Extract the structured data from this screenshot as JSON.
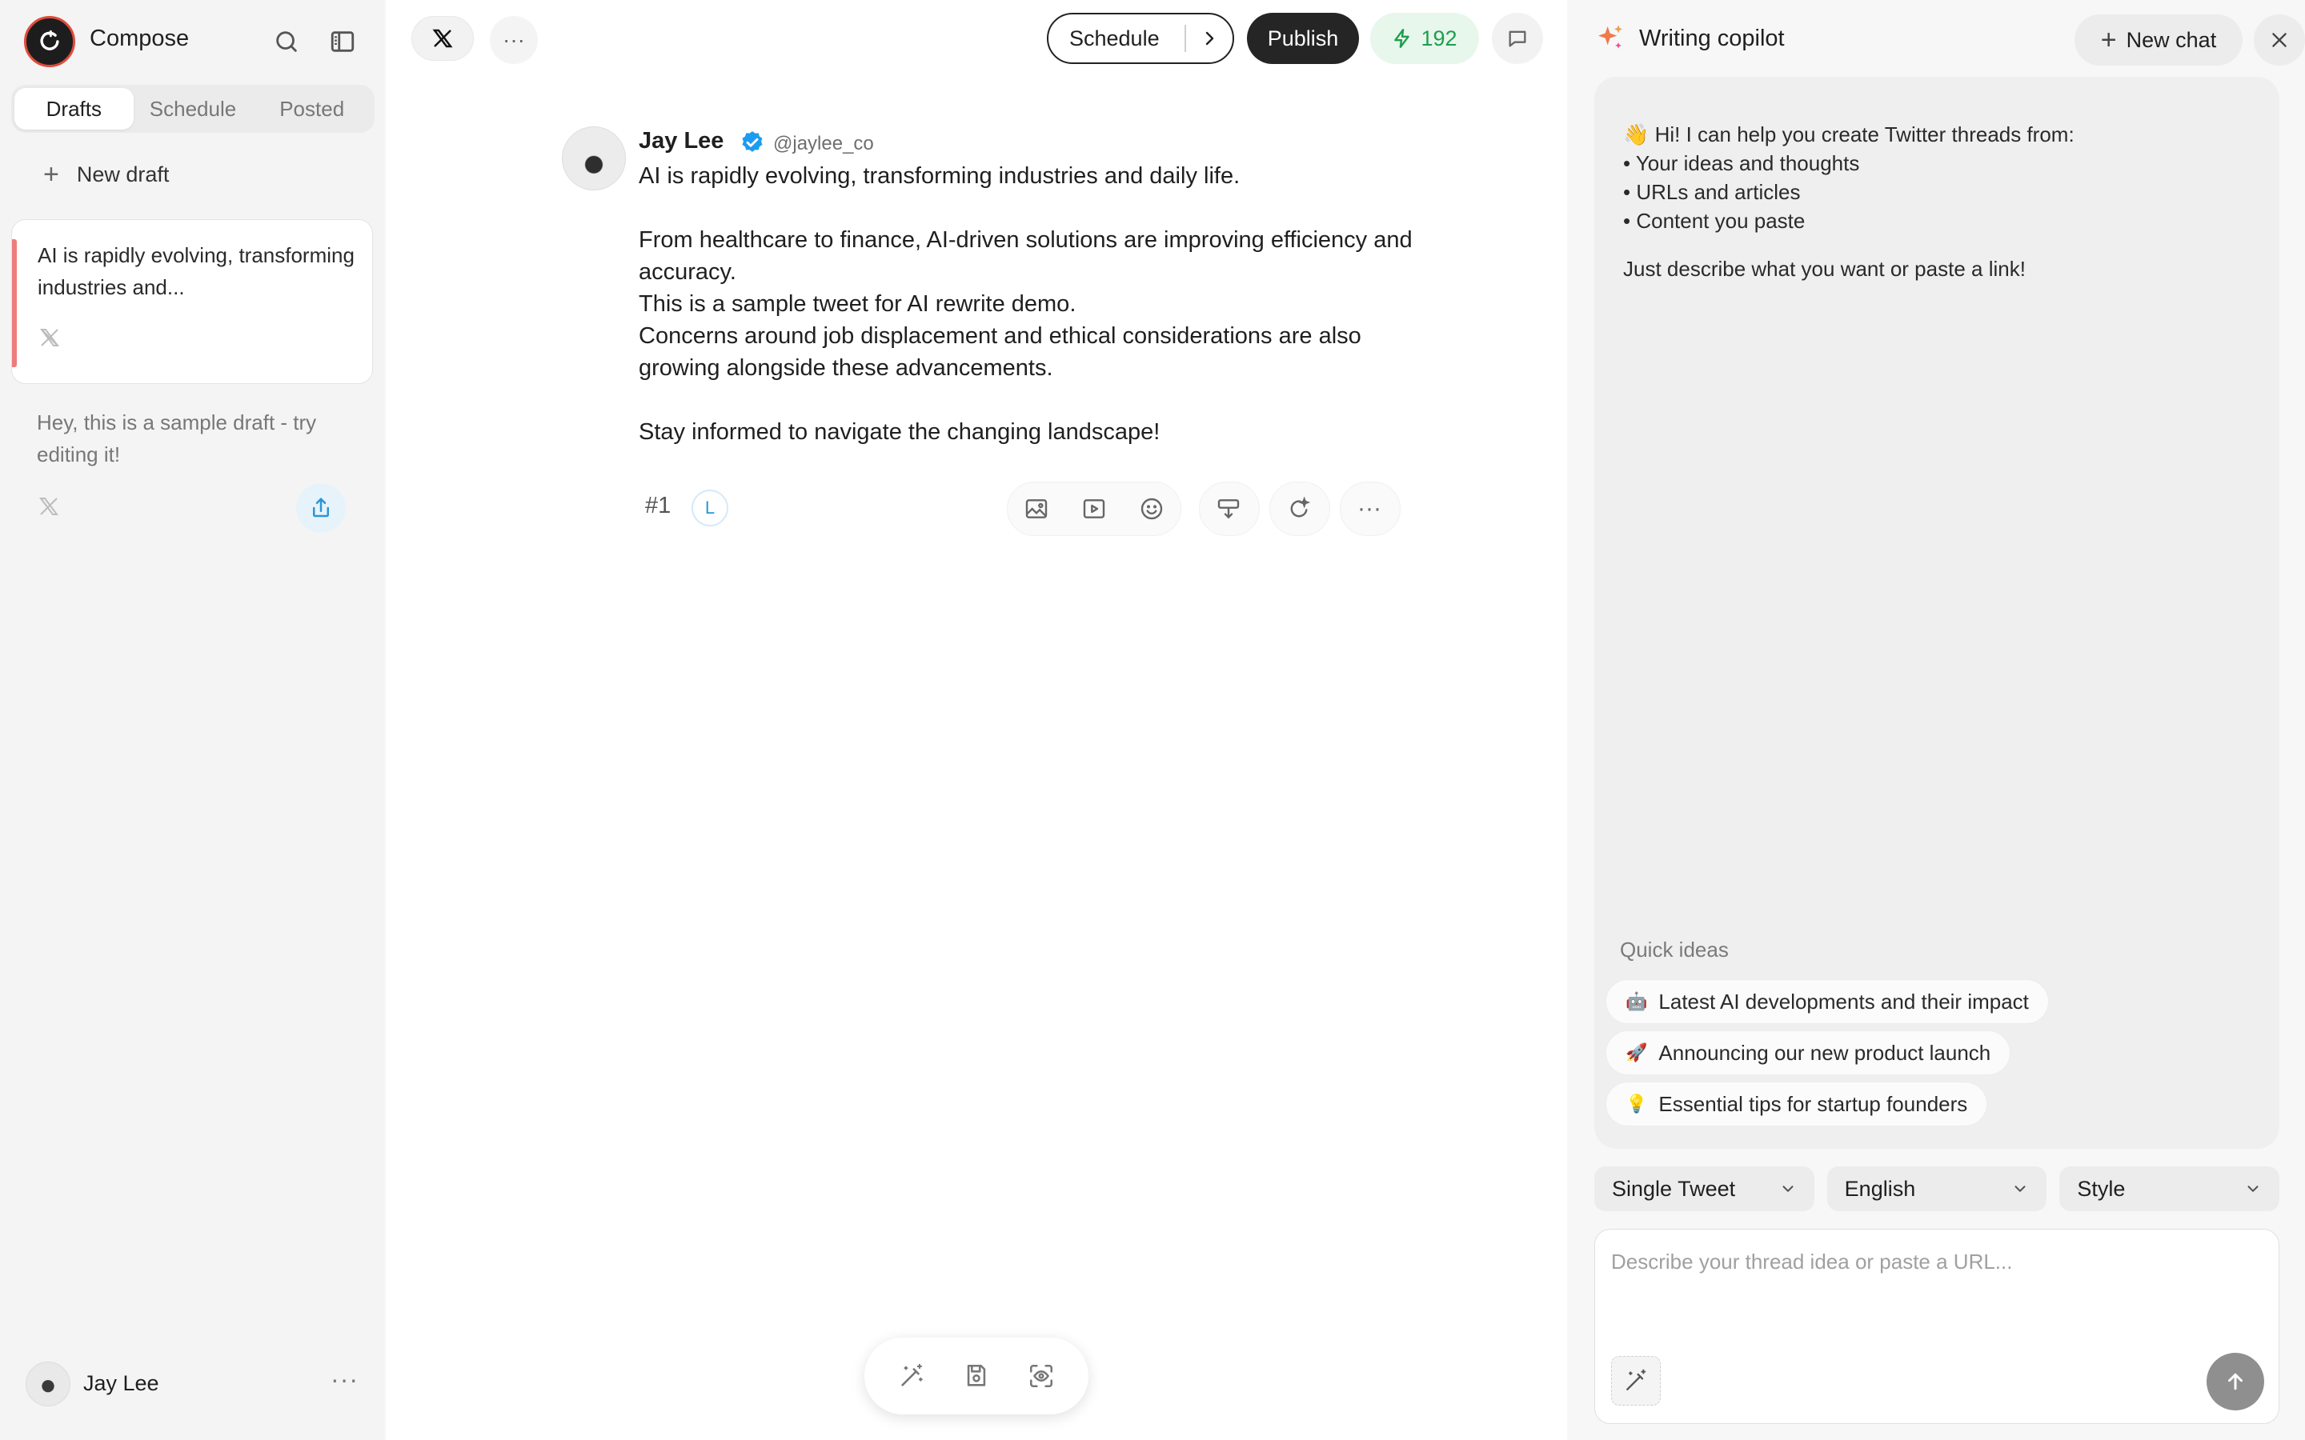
{
  "sidebar": {
    "title": "Compose",
    "tabs": [
      {
        "label": "Drafts",
        "active": true
      },
      {
        "label": "Schedule",
        "active": false
      },
      {
        "label": "Posted",
        "active": false
      }
    ],
    "new_draft_label": "New draft",
    "drafts": [
      {
        "text": "AI is rapidly evolving, transforming industries and...",
        "platform_icon": "x-logo-icon",
        "selected": true
      },
      {
        "text": "Hey, this is a sample draft - try editing it!",
        "platform_icon": "x-logo-icon",
        "selected": false
      }
    ],
    "user": {
      "name": "Jay Lee"
    }
  },
  "toolbar": {
    "platform_icon": "x-logo-icon",
    "schedule_label": "Schedule",
    "publish_label": "Publish",
    "credits": "192",
    "credits_color": "#1e9e4d"
  },
  "tweet": {
    "author": "Jay Lee",
    "handle": "@jaylee_co",
    "verified": true,
    "lines": [
      "AI is rapidly evolving, transforming industries and daily life.",
      "",
      "From healthcare to finance, AI-driven solutions are improving efficiency and accuracy.",
      "This is a sample tweet for AI rewrite demo.",
      "Concerns around job displacement and ethical considerations are also growing alongside these advancements.",
      "",
      "Stay informed to navigate the changing landscape!"
    ],
    "number": "#1",
    "user_badge": "L"
  },
  "copilot": {
    "title": "Writing copilot",
    "new_chat_label": "New chat",
    "greeting": "👋 Hi! I can help you create Twitter threads from:",
    "bullets": [
      "• Your ideas and thoughts",
      "• URLs and articles",
      "• Content you paste"
    ],
    "closing": "Just describe what you want or paste a link!",
    "quick_ideas_label": "Quick ideas",
    "quick_ideas": [
      {
        "emoji": "🤖",
        "text": "Latest AI developments and their impact"
      },
      {
        "emoji": "🚀",
        "text": "Announcing our new product launch"
      },
      {
        "emoji": "💡",
        "text": "Essential tips for startup founders"
      }
    ],
    "selects": {
      "format": "Single Tweet",
      "language": "English",
      "style": "Style"
    },
    "input_placeholder": "Describe your thread idea or paste a URL..."
  },
  "colors": {
    "accent_draft": "#ef7b7b",
    "verified": "#1d9bf0",
    "publish_bg": "#252525"
  }
}
